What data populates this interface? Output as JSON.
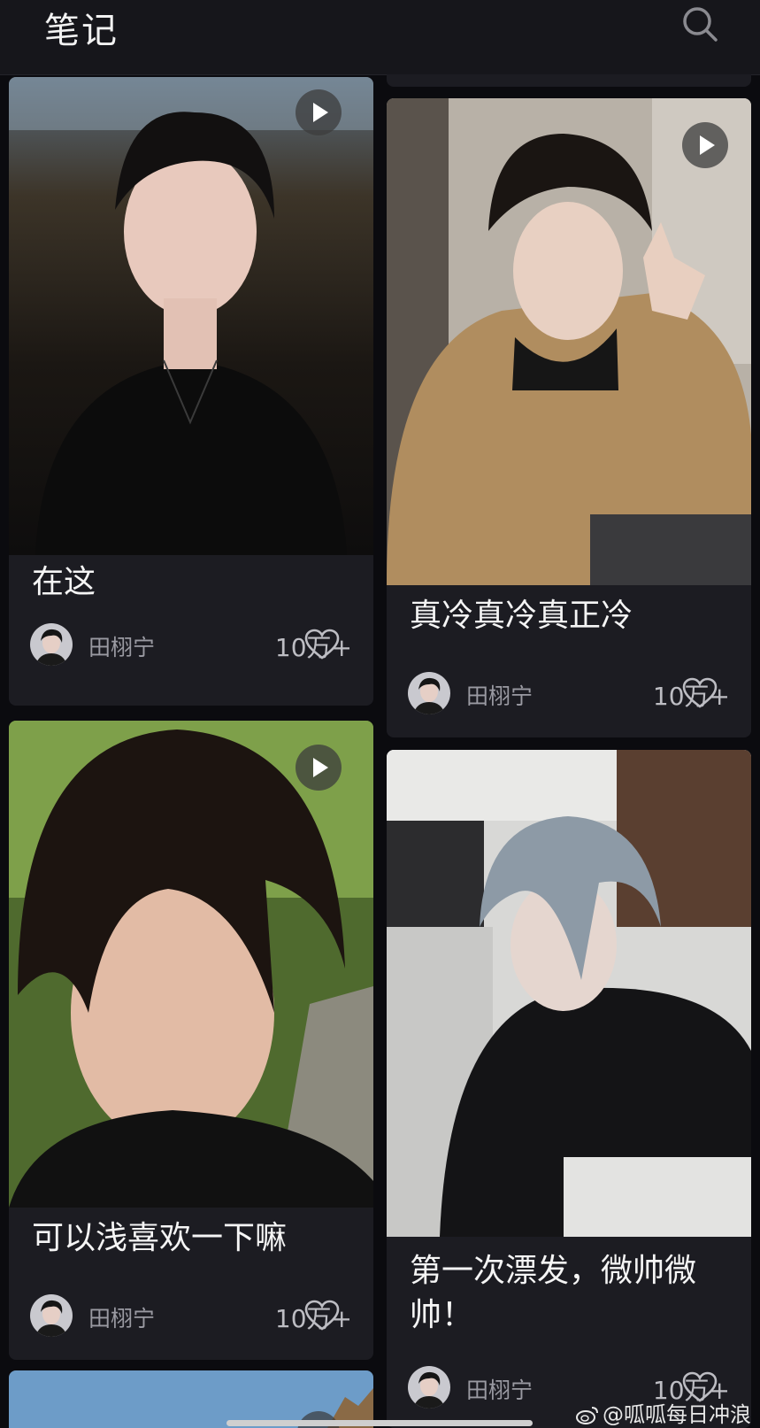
{
  "header": {
    "title": "笔记",
    "search_icon": "search-icon"
  },
  "notes": [
    {
      "title": "在这",
      "author": "田栩宁",
      "likes": "10万+",
      "is_video": true
    },
    {
      "title": "真冷真冷真正冷",
      "author": "田栩宁",
      "likes": "10万+",
      "is_video": true
    },
    {
      "title": "可以浅喜欢一下嘛",
      "author": "田栩宁",
      "likes": "10万+",
      "is_video": true
    },
    {
      "title": "第一次漂发，微帅微帅！",
      "author": "田栩宁",
      "likes": "10万+",
      "is_video": false
    }
  ],
  "watermark": "@呱呱每日冲浪",
  "colors": {
    "background": "#0b0b0f",
    "card": "#1c1c22",
    "header": "#16161b",
    "text_primary": "#f5f5f5",
    "text_secondary": "#9a9aa2"
  }
}
